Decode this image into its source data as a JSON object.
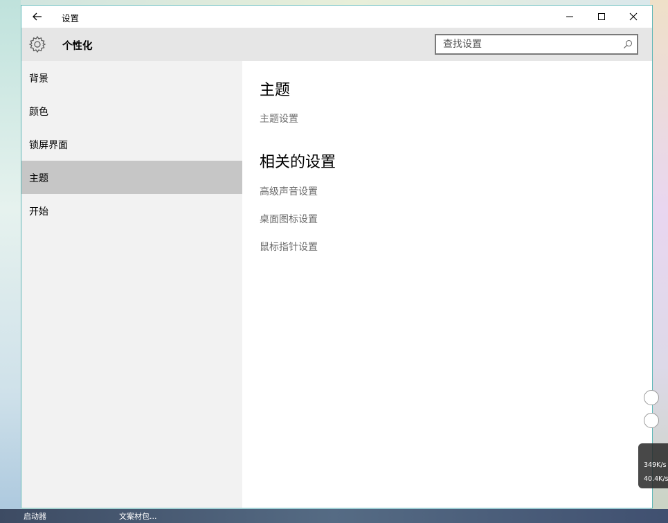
{
  "window": {
    "app_title": "设置"
  },
  "header": {
    "title": "个性化",
    "search_placeholder": "查找设置"
  },
  "sidebar": {
    "items": [
      {
        "label": "背景"
      },
      {
        "label": "颜色"
      },
      {
        "label": "锁屏界面"
      },
      {
        "label": "主题"
      },
      {
        "label": "开始"
      }
    ]
  },
  "content": {
    "section1_title": "主题",
    "section1_links": [
      {
        "label": "主题设置"
      }
    ],
    "section2_title": "相关的设置",
    "section2_links": [
      {
        "label": "高级声音设置"
      },
      {
        "label": "桌面图标设置"
      },
      {
        "label": "鼠标指针设置"
      }
    ]
  },
  "desktop": {
    "icon_label_1": "启动器",
    "icon_label_2": "文案材包...",
    "net_upload": "349K/s",
    "net_download": "40.4K/s"
  },
  "colors": {
    "header_bg": "#e6e6e6",
    "sidebar_bg": "#f2f2f2",
    "active_item_bg": "#c6c6c6",
    "link_color": "#6d6d6d",
    "window_border": "#5fb8b8"
  }
}
